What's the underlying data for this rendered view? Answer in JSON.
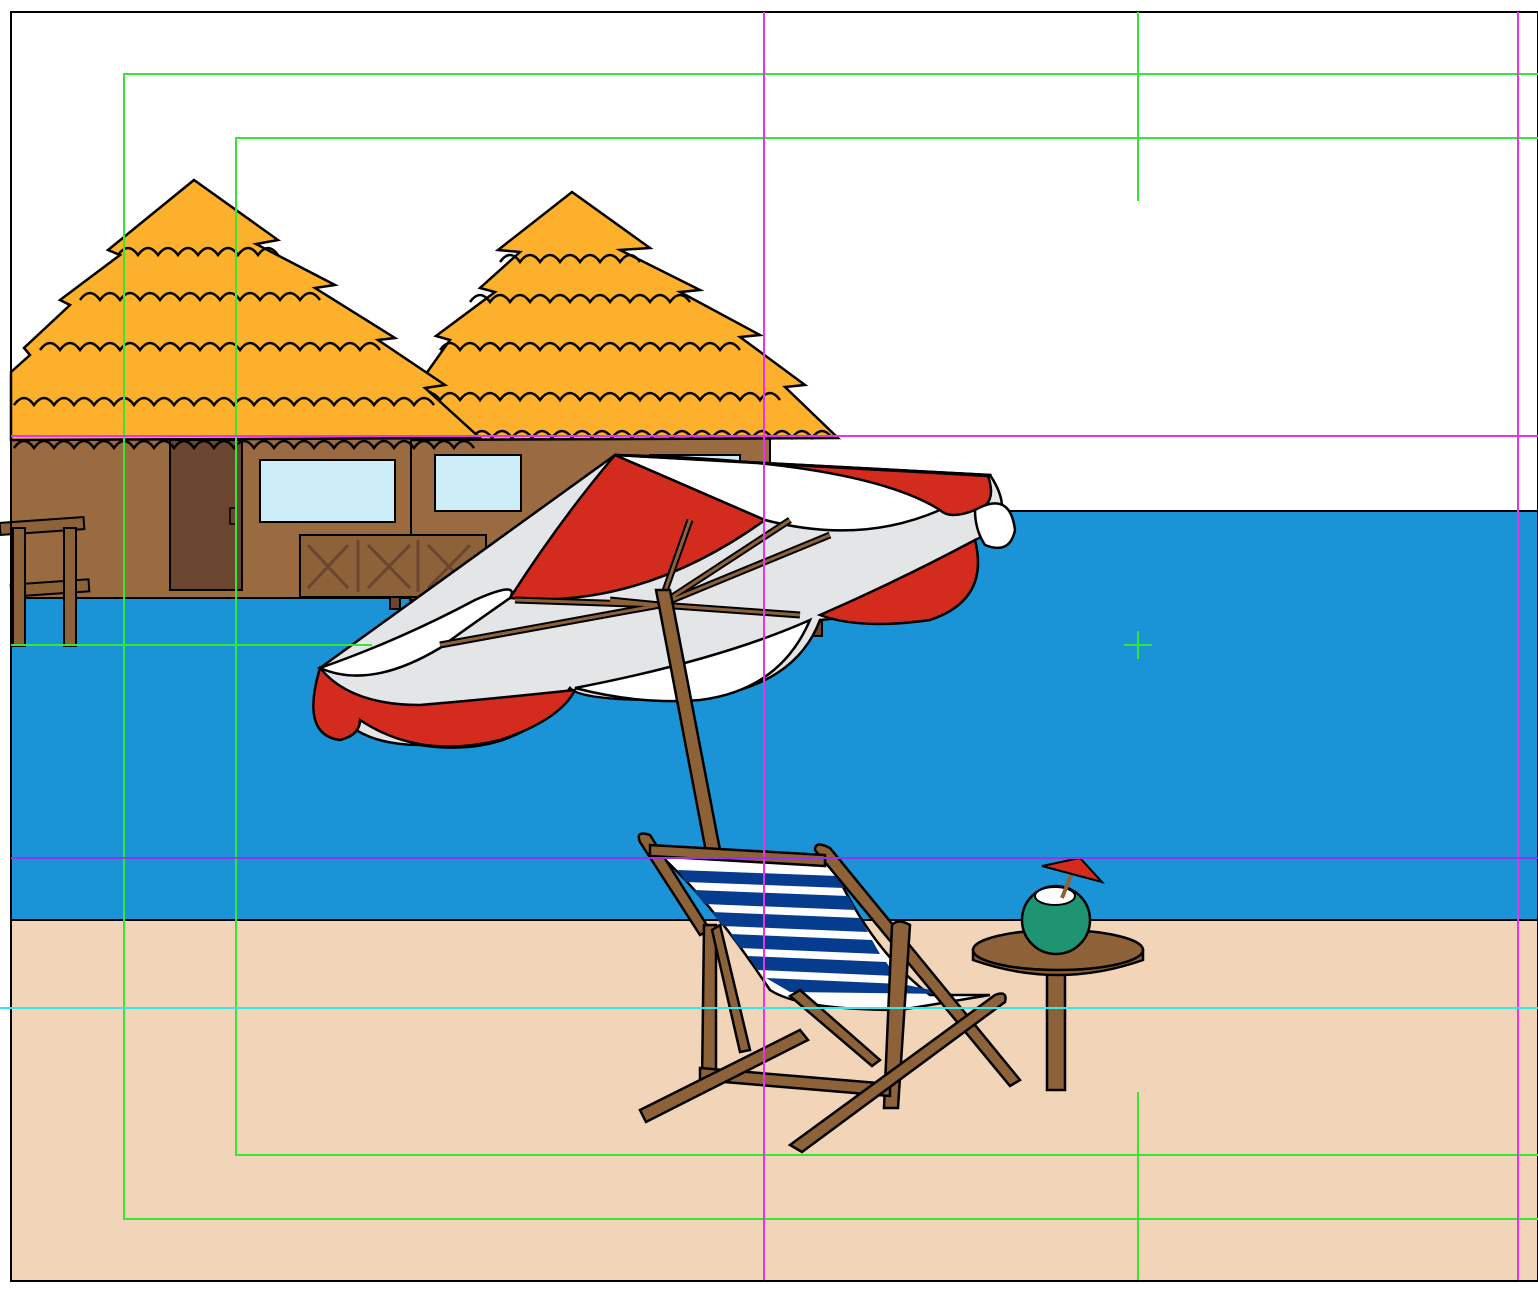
{
  "colors": {
    "background": "#ffffff",
    "sea": "#1a94d6",
    "sand": "#f2d4b8",
    "thatch": "#fcb02b",
    "hut_wall": "#9a6b40",
    "hut_dark": "#6a4530",
    "window": "#cdeef8",
    "umbrella_red": "#d42b1f",
    "umbrella_white": "#ffffff",
    "umbrella_grey": "#e4e5e7",
    "wood": "#8e6238",
    "stripe_blue": "#053c8e",
    "coconut": "#1f9473",
    "outline": "#000000",
    "guide_green": "#33e833",
    "guide_magenta": "#e833e8",
    "guide_cyan": "#33e8e8",
    "guide_purple": "#9a33e8"
  },
  "objects": {
    "huts": "thatched-hut",
    "umbrella": "beach-umbrella",
    "chair": "deck-chair",
    "table": "side-table",
    "drink": "coconut-drink"
  }
}
